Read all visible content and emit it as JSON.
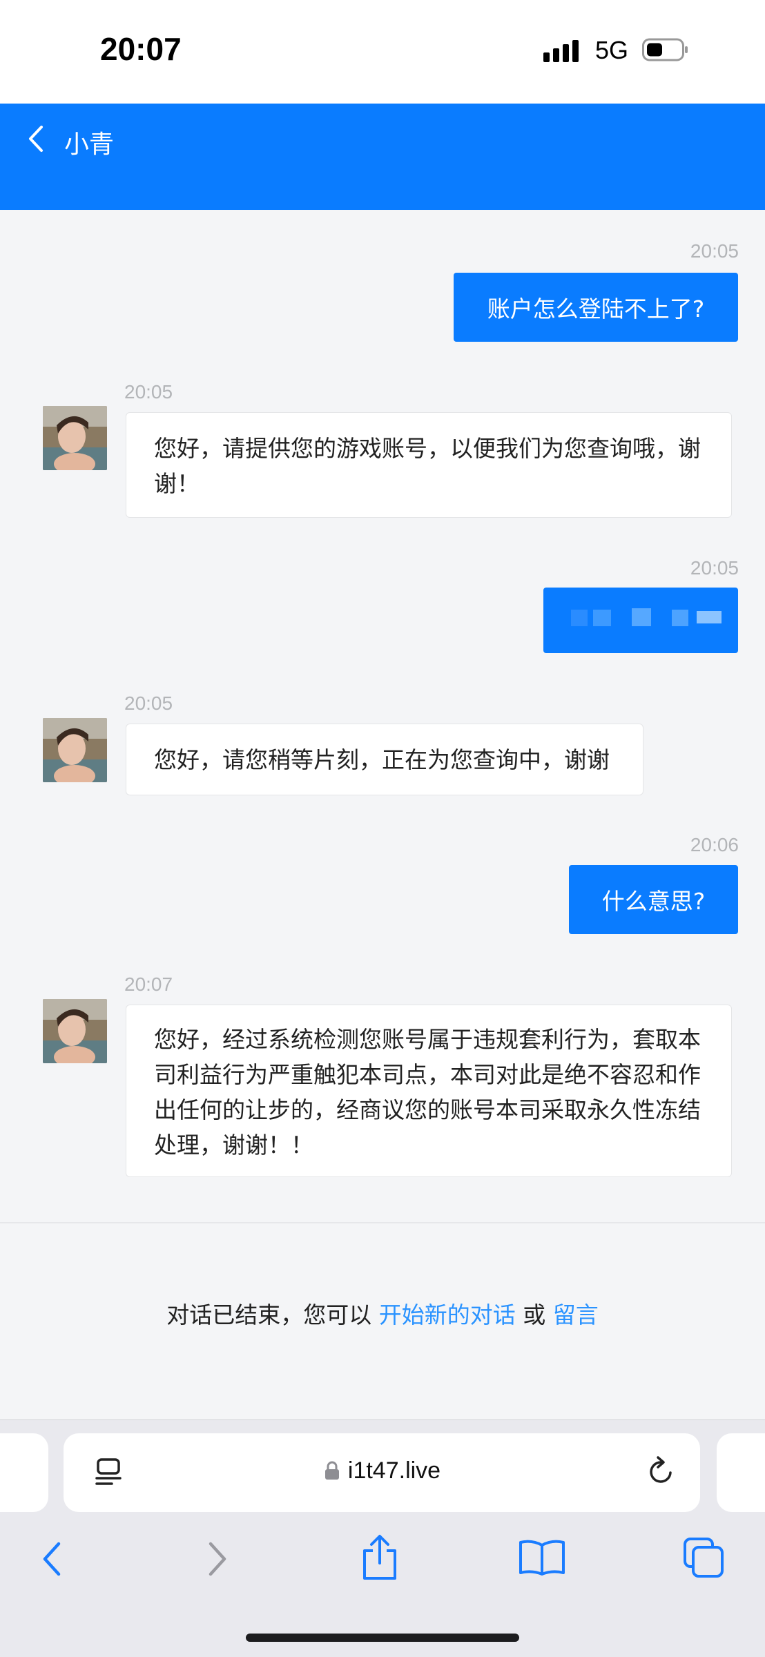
{
  "status_bar": {
    "time": "20:07",
    "network": "5G"
  },
  "header": {
    "title": "小青"
  },
  "messages": [
    {
      "time": "20:05",
      "text": "账户怎么登陆不上了?"
    },
    {
      "time": "20:05",
      "text": "您好，请提供您的游戏账号，以便我们为您查询哦，谢谢！"
    },
    {
      "time": "20:05",
      "text": ""
    },
    {
      "time": "20:05",
      "text": "您好，请您稍等片刻，正在为您查询中，谢谢"
    },
    {
      "time": "20:06",
      "text": "什么意思?"
    },
    {
      "time": "20:07",
      "text": "您好，经过系统检测您账号属于违规套利行为，套取本司利益行为严重触犯本司点，本司对此是绝不容忍和作出任何的让步的，经商议您的账号本司采取永久性冻结处理，谢谢！！"
    }
  ],
  "ended": {
    "prefix": "对话已结束，您可以",
    "link_new": "开始新的对话",
    "or": "或",
    "link_leave": "留言"
  },
  "browser": {
    "url": "i1t47.live"
  },
  "colors": {
    "accent": "#0a7cff",
    "link": "#2a93ff"
  },
  "icons": [
    "signal-icon",
    "battery-icon",
    "back-chevron-icon",
    "reader-icon",
    "lock-icon",
    "reload-icon",
    "browser-back-icon",
    "browser-forward-icon",
    "share-icon",
    "bookmarks-icon",
    "tabs-icon"
  ]
}
